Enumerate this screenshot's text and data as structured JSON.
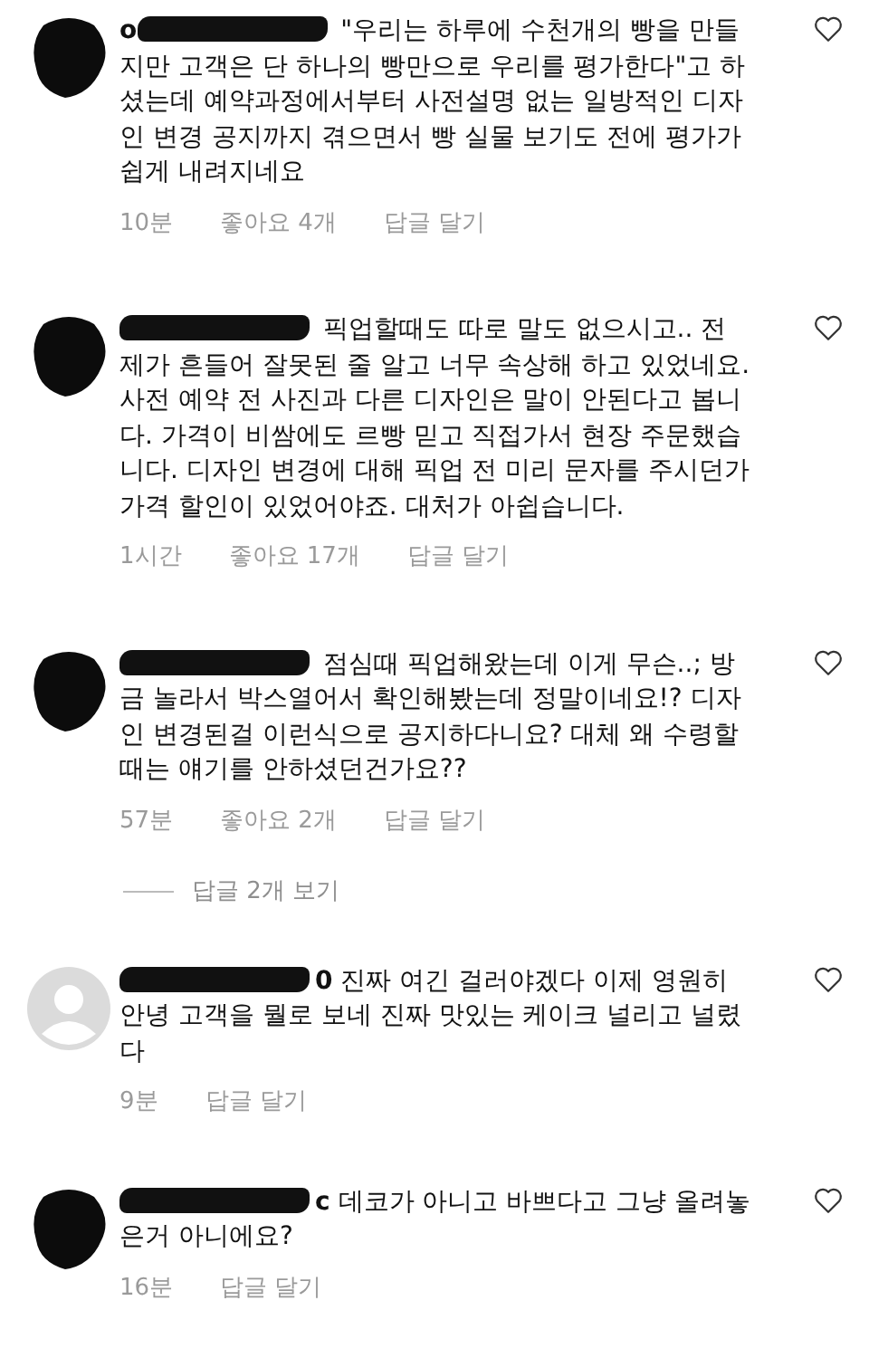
{
  "comments": [
    {
      "avatar": {
        "kind": "redacted"
      },
      "username_visible": "o",
      "text": "\"우리는 하루에 수천개의 빵을 만들지만 고객은 단 하나의 빵만으로 우리를 평가한다\"고 하셨는데 예약과정에서부터 사전설명 없는 일방적인 디자인 변경 공지까지 겪으면서 빵 실물 보기도 전에 평가가 쉽게 내려지네요",
      "time": "10분",
      "likes": "좋아요 4개",
      "reply": "답글 달기"
    },
    {
      "avatar": {
        "kind": "redacted"
      },
      "text": "픽업할때도 따로 말도 없으시고.. 전 제가 흔들어 잘못된 줄 알고 너무 속상해 하고 있었네요. 사전 예약 전 사진과 다른 디자인은 말이 안된다고 봅니다. 가격이 비쌈에도 르빵 믿고 직접가서 현장 주문했습니다. 디자인 변경에 대해 픽업 전 미리 문자를 주시던가 가격 할인이 있었어야죠. 대처가 아쉽습니다.",
      "time": "1시간",
      "likes": "좋아요 17개",
      "reply": "답글 달기"
    },
    {
      "avatar": {
        "kind": "redacted"
      },
      "text": "점심때 픽업해왔는데 이게 무슨..; 방금 놀라서 박스열어서 확인해봤는데 정말이네요!? 디자인 변경된걸 이런식으로 공지하다니요? 대체 왜 수령할때는 얘기를 안하셨던건가요??",
      "time": "57분",
      "likes": "좋아요 2개",
      "reply": "답글 달기",
      "view_replies": "답글 2개 보기"
    },
    {
      "avatar": {
        "kind": "default"
      },
      "username_visible": "0",
      "text": "진짜 여긴 걸러야겠다 이제 영원히 안녕 고객을 뭘로 보네 진짜 맛있는 케이크 널리고 널렸다",
      "time": "9분",
      "reply": "답글 달기"
    },
    {
      "avatar": {
        "kind": "redacted"
      },
      "username_visible": "c",
      "text": "데코가 아니고 바쁘다고 그냥 올려놓은거 아니에요?",
      "time": "16분",
      "reply": "답글 달기"
    }
  ]
}
